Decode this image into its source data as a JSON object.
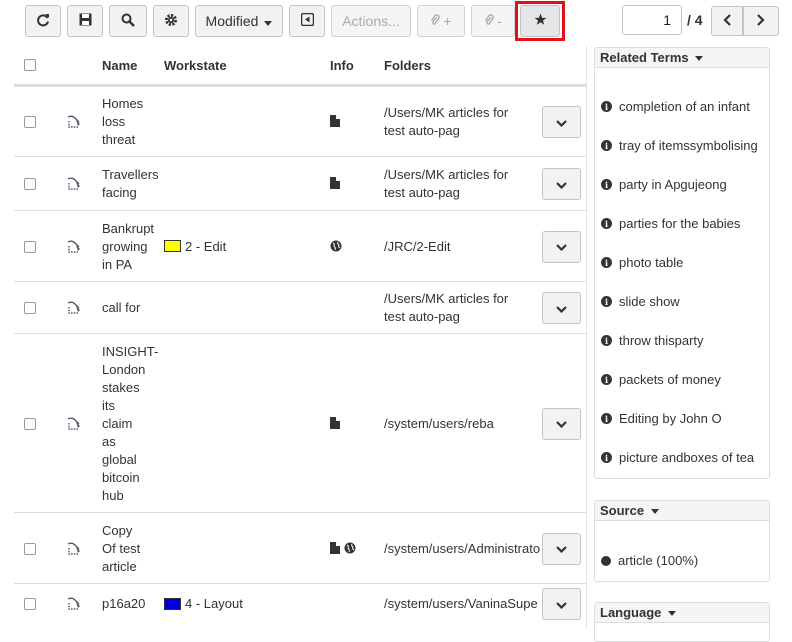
{
  "toolbar": {
    "refresh_icon": "refresh-icon",
    "save_icon": "save-icon",
    "search_icon": "search-icon",
    "settings_icon": "gear-icon",
    "modified_label": "Modified",
    "collapse_icon": "collapse-left-icon",
    "actions_label": "Actions...",
    "attach_add_label": "+",
    "attach_remove_label": "-",
    "star_icon": "star-icon"
  },
  "pager": {
    "current": "1",
    "total": "/ 4"
  },
  "table": {
    "headers": {
      "name": "Name",
      "workstate": "Workstate",
      "info": "Info",
      "folders": "Folders"
    },
    "rows": [
      {
        "name": [
          "Homes",
          "loss",
          "threat"
        ],
        "workstate": "",
        "workstate_color": "",
        "info": [
          "document"
        ],
        "folder": [
          "/Users/MK articles for",
          "test auto-pag"
        ]
      },
      {
        "name": [
          "Travellers",
          "facing"
        ],
        "workstate": "",
        "workstate_color": "",
        "info": [
          "document"
        ],
        "folder": [
          "/Users/MK articles for",
          "test auto-pag"
        ]
      },
      {
        "name": [
          "Bankrupt",
          "growing",
          "in PA"
        ],
        "workstate": "2 - Edit",
        "workstate_color": "#ffff00",
        "info": [
          "globe"
        ],
        "folder": [
          "/JRC/2-Edit"
        ]
      },
      {
        "name": [
          "call for"
        ],
        "workstate": "",
        "workstate_color": "",
        "info": [],
        "folder": [
          "/Users/MK articles for",
          "test auto-pag"
        ]
      },
      {
        "name": [
          "INSIGHT-",
          "London",
          "stakes",
          "its",
          "claim",
          "as",
          "global",
          "bitcoin",
          "hub"
        ],
        "workstate": "",
        "workstate_color": "",
        "info": [
          "document"
        ],
        "folder": [
          "/system/users/reba"
        ]
      },
      {
        "name": [
          "Copy",
          "Of test",
          "article"
        ],
        "workstate": "",
        "workstate_color": "",
        "info": [
          "document",
          "globe"
        ],
        "folder": [
          "/system/users/Administrato"
        ]
      },
      {
        "name": [
          "p16a20"
        ],
        "workstate": "4 - Layout",
        "workstate_color": "#0000dd",
        "info": [],
        "folder": [
          "/system/users/VaninaSupe"
        ]
      }
    ]
  },
  "related_terms": {
    "title": "Related Terms",
    "items": [
      "completion of an infant",
      "tray of itemssymbolising",
      "party in Apgujeong",
      "parties for the babies",
      "photo table",
      "slide show",
      "throw thisparty",
      "packets of money",
      "Editing by John O",
      "picture andboxes of tea"
    ]
  },
  "source": {
    "title": "Source",
    "items": [
      "article (100%)"
    ]
  },
  "language": {
    "title": "Language"
  }
}
